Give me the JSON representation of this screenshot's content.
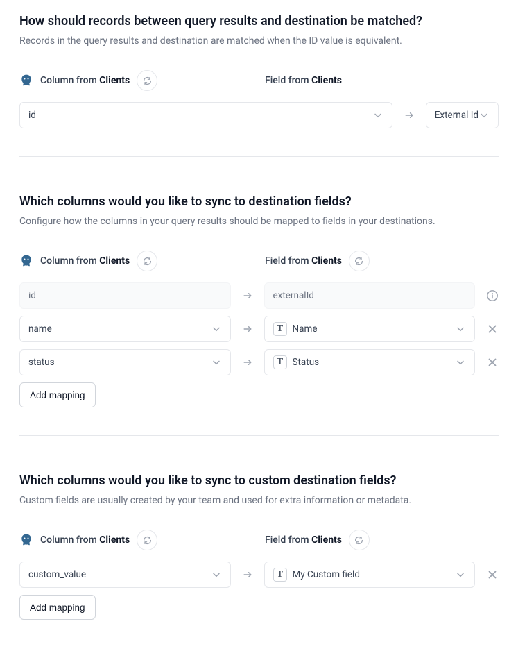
{
  "source_name": "Clients",
  "match": {
    "title": "How should records between query results and destination be matched?",
    "desc": "Records in the query results and destination are matched when the ID value is equivalent.",
    "left_label_prefix": "Column from ",
    "right_label_prefix": "Field from ",
    "left_value": "id",
    "right_value": "External Id"
  },
  "sync": {
    "title": "Which columns would you like to sync to destination fields?",
    "desc": "Configure how the columns in your query results should be mapped to fields in your destinations.",
    "left_label_prefix": "Column from ",
    "right_label_prefix": "Field from ",
    "rows": [
      {
        "left": "id",
        "right": "externalId",
        "locked": true
      },
      {
        "left": "name",
        "right": "Name",
        "locked": false
      },
      {
        "left": "status",
        "right": "Status",
        "locked": false
      }
    ],
    "add_label": "Add mapping"
  },
  "custom": {
    "title": "Which columns would you like to sync to custom destination fields?",
    "desc": "Custom fields are usually created by your team and used for extra information or metadata.",
    "left_label_prefix": "Column from ",
    "right_label_prefix": "Field from ",
    "rows": [
      {
        "left": "custom_value",
        "right": "My Custom field"
      }
    ],
    "add_label": "Add mapping"
  }
}
